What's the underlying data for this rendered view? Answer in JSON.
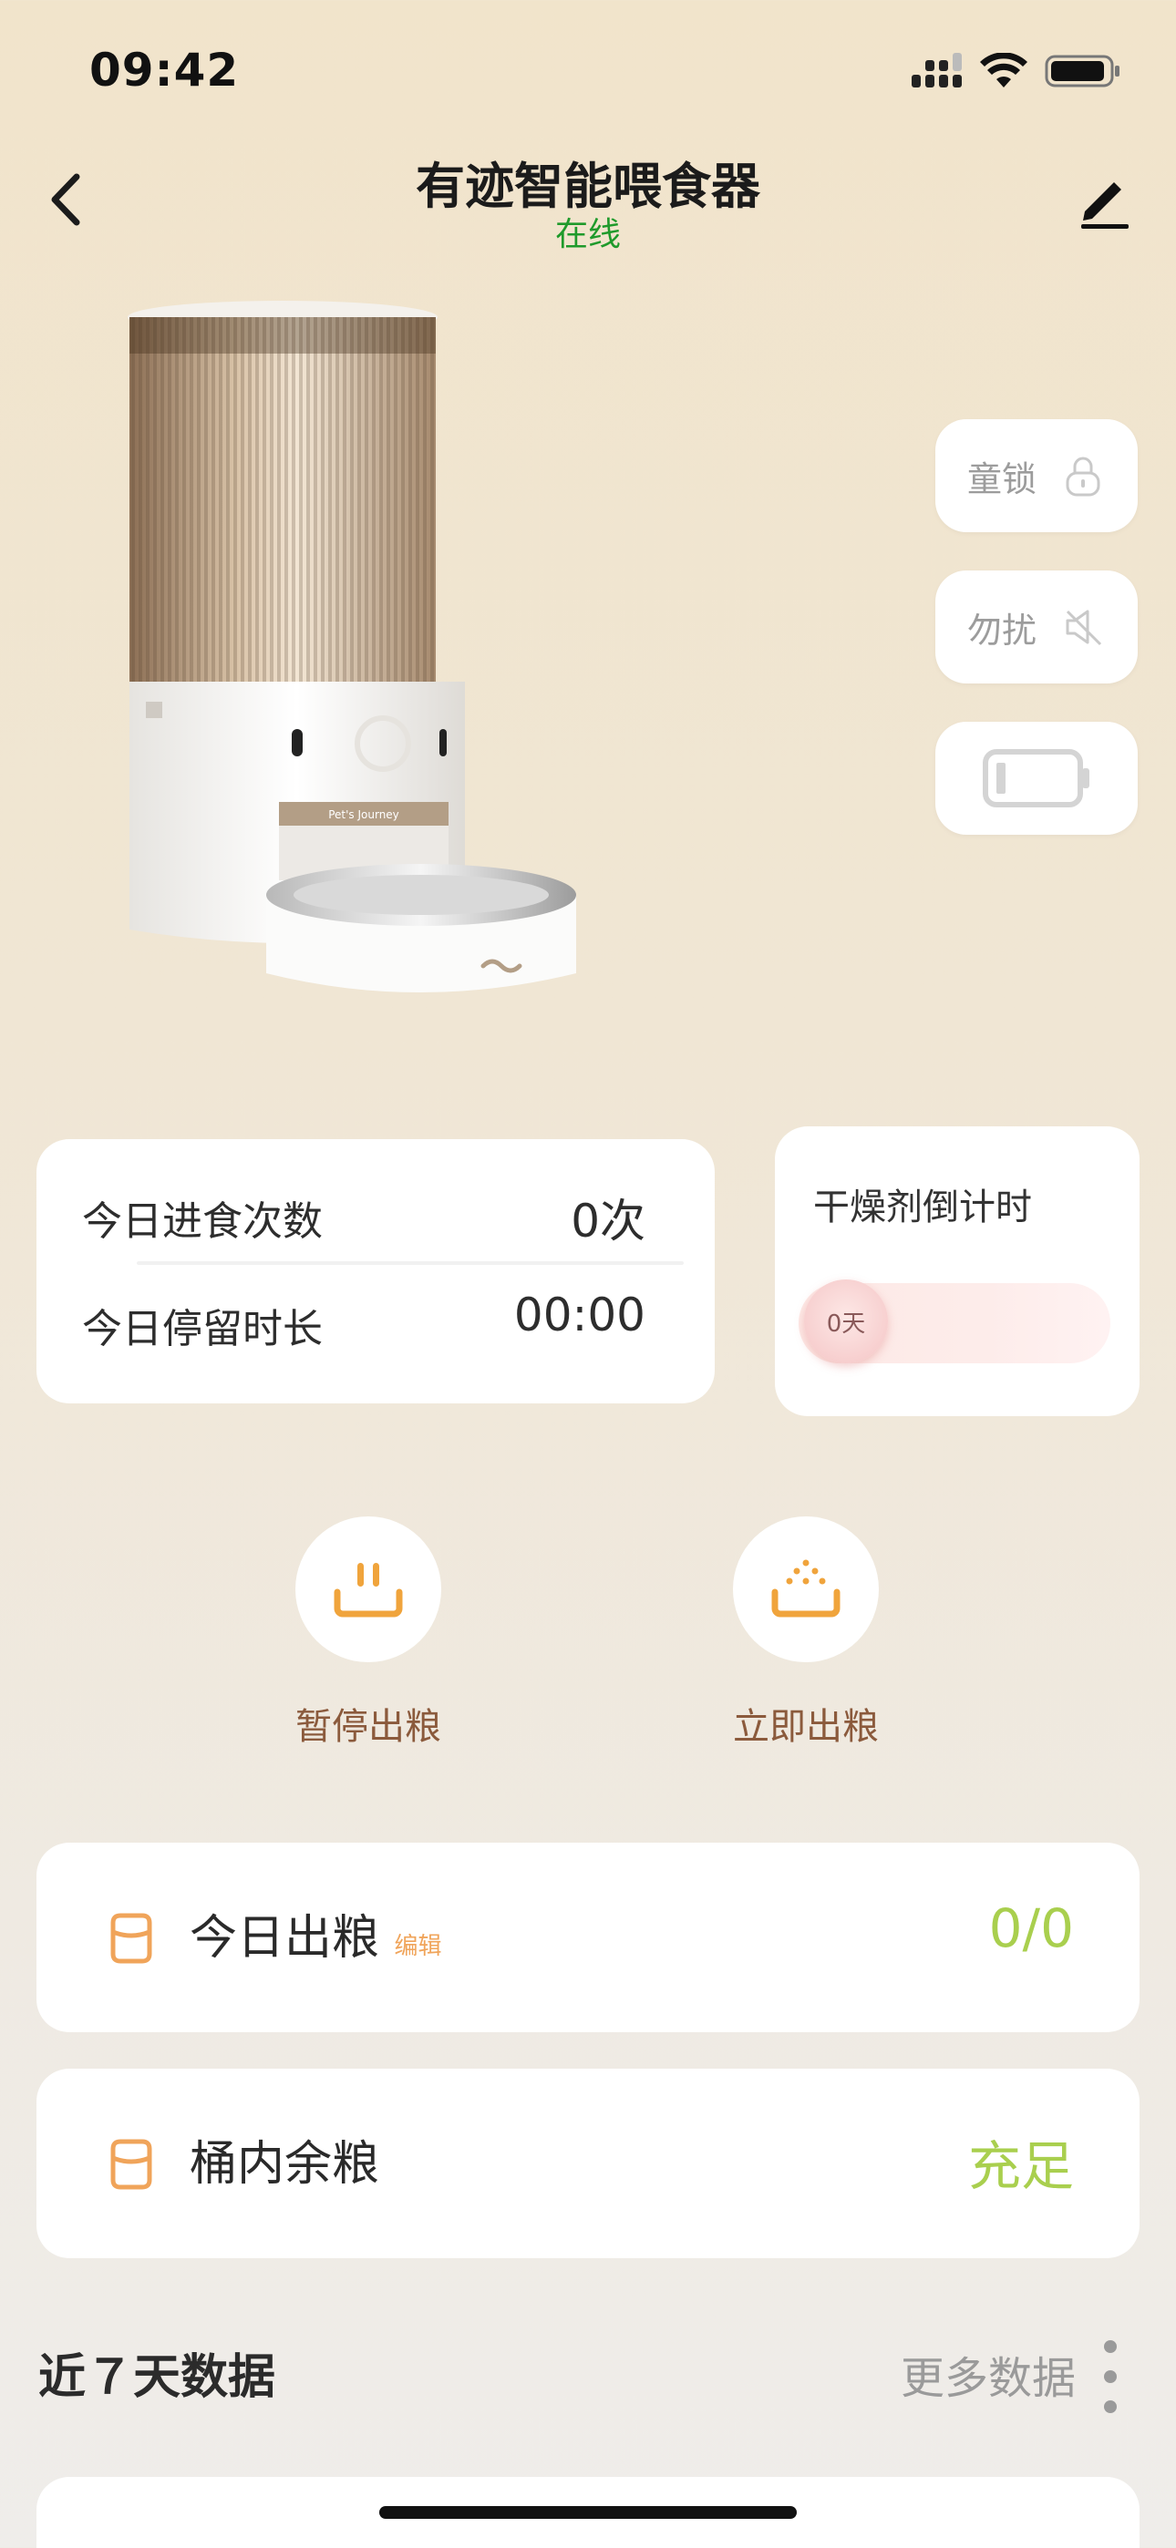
{
  "status_bar": {
    "time": "09:42"
  },
  "nav": {
    "title": "有迹智能喂食器",
    "status": "在线"
  },
  "side_controls": [
    {
      "label": "童锁",
      "icon": "lock-icon"
    },
    {
      "label": "勿扰",
      "icon": "mute-icon"
    },
    {
      "label": "",
      "icon": "battery-icon"
    }
  ],
  "product": {
    "brand_text": "Pet's Journey"
  },
  "stats": {
    "meals_label": "今日进食次数",
    "meals_value": "0次",
    "duration_label": "今日停留时长",
    "duration_value": "00:00"
  },
  "desiccant": {
    "title": "干燥剂倒计时",
    "days": "0天",
    "level": 0
  },
  "actions": [
    {
      "label": "暂停出粮",
      "icon": "pause-feed-icon"
    },
    {
      "label": "立即出粮",
      "icon": "dispense-feed-icon"
    }
  ],
  "rows": {
    "today_feed": {
      "label": "今日出粮",
      "edit": "编辑",
      "value": "0/0"
    },
    "remaining": {
      "label": "桶内余粮",
      "value": "充足"
    }
  },
  "section": {
    "title": "近７天数据",
    "more": "更多数据"
  },
  "colors": {
    "online": "#1f9a2b",
    "value_green": "#a9cf4e",
    "action_brown": "#8b5a3c",
    "accent_orange": "#f0a45a"
  }
}
